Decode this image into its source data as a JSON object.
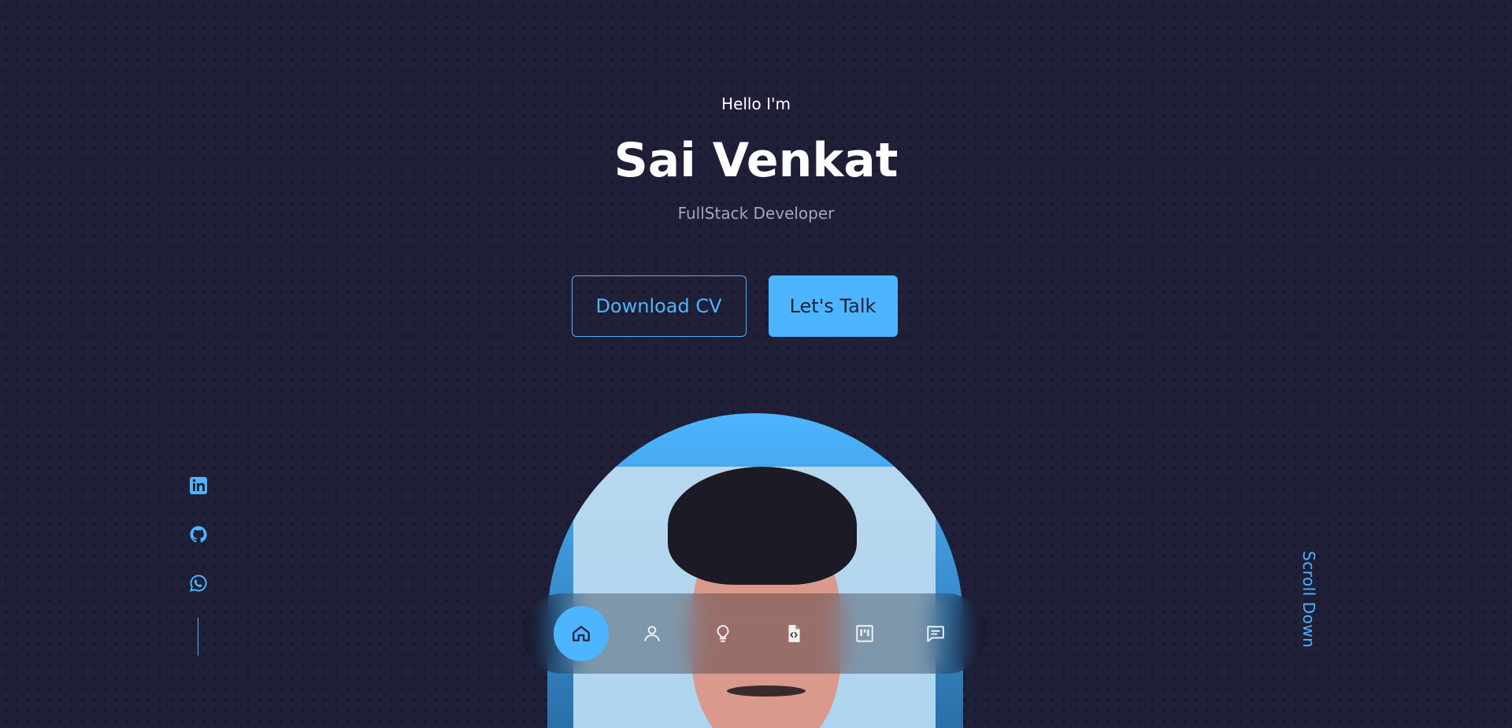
{
  "hero": {
    "greeting": "Hello I'm",
    "name": "Sai Venkat",
    "role": "FullStack Developer"
  },
  "buttons": {
    "download_cv": "Download CV",
    "lets_talk": "Let's Talk"
  },
  "socials": [
    {
      "icon": "linkedin-icon"
    },
    {
      "icon": "github-icon"
    },
    {
      "icon": "whatsapp-icon"
    }
  ],
  "scroll": {
    "label": "Scroll Down"
  },
  "nav": {
    "items": [
      {
        "icon": "home-icon",
        "active": true
      },
      {
        "icon": "user-icon",
        "active": false
      },
      {
        "icon": "lightbulb-icon",
        "active": false
      },
      {
        "icon": "code-file-icon",
        "active": false
      },
      {
        "icon": "kanban-icon",
        "active": false
      },
      {
        "icon": "message-icon",
        "active": false
      }
    ]
  },
  "colors": {
    "background": "#1f1f38",
    "accent": "#4db5ff",
    "muted_text": "#a7a7b8"
  }
}
